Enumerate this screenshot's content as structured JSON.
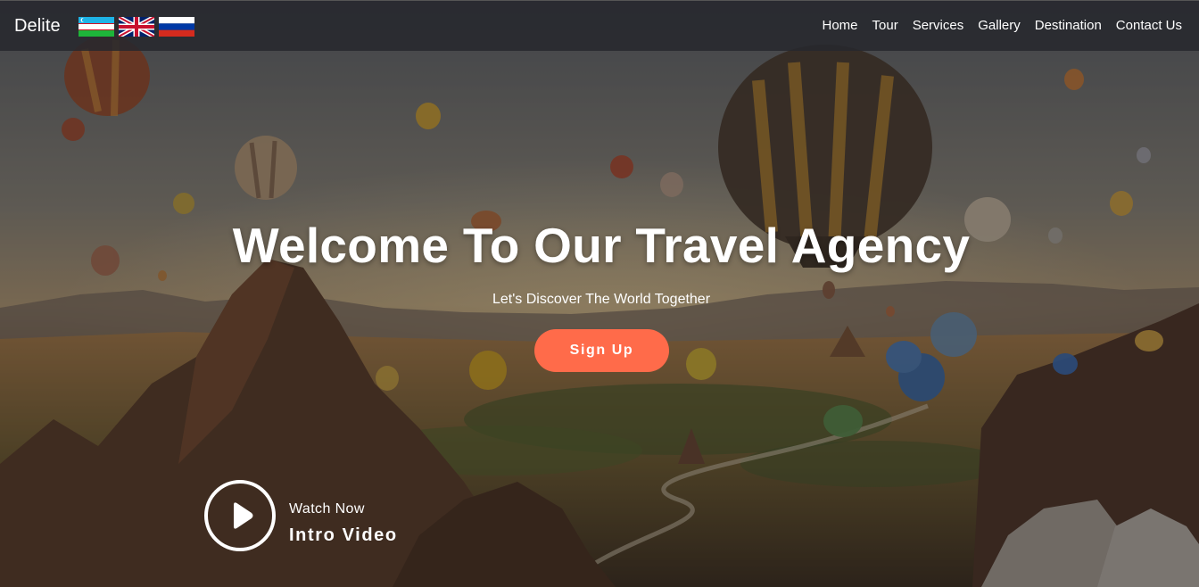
{
  "nav": {
    "brand": "Delite",
    "flags": [
      {
        "name": "uzbekistan-flag-icon",
        "colors": [
          "#1eb3e6",
          "#ffffff",
          "#1eb53a"
        ]
      },
      {
        "name": "uk-flag-icon",
        "colors": [
          "#012169",
          "#ffffff",
          "#c8102e"
        ]
      },
      {
        "name": "russia-flag-icon",
        "colors": [
          "#ffffff",
          "#0039a6",
          "#d52b1e"
        ]
      }
    ],
    "links": [
      "Home",
      "Tour",
      "Services",
      "Gallery",
      "Destination",
      "Contact Us"
    ]
  },
  "hero": {
    "title": "Welcome To Our Travel Agency",
    "subtitle": "Let's Discover The World Together",
    "signup_label": "Sign Up",
    "background": "hot-air-balloons-cappadocia-landscape"
  },
  "video": {
    "icon": "play-icon",
    "caption_small": "Watch Now",
    "caption_large": "Intro Video"
  },
  "colors": {
    "accent": "#ff6b4a",
    "navbar": "#26282d",
    "text": "#ffffff"
  }
}
